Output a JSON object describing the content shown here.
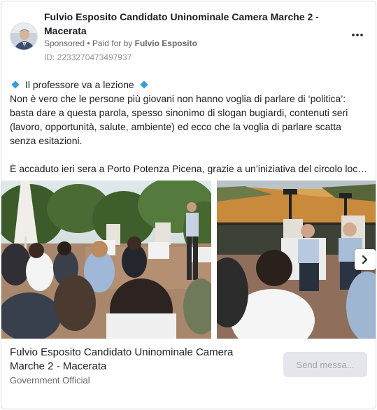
{
  "ad": {
    "page_name": "Fulvio Esposito Candidato Uninominale Camera Marche 2 - Macerata",
    "sponsored_label": "Sponsored",
    "separator": " • ",
    "paid_for_label": "Paid for by ",
    "paid_for_name": "Fulvio Esposito",
    "id_label": "ID: 2233270473497937",
    "more_icon": "more-horizontal-icon"
  },
  "body": {
    "headline": "Il professore va a lezione",
    "paragraph_1": "Non è vero che le persone più giovani non hanno voglia di parlare di ‘politica’: basta dare a questa parola, spesso sinonimo di slogan bugiardi, contenuti seri (lavoro, opportunità, salute, ambiente) ed ecco che la voglia di parlare scatta senza esitazioni.",
    "paragraph_2": "È accaduto ieri sera a Porto Potenza Picena, grazie a un’iniziativa del circolo local...",
    "bullet_icon": "blue-diamond-icon"
  },
  "carousel": {
    "next_icon": "chevron-right-icon",
    "photos": [
      "outdoor-terrace-meeting-photo",
      "terrace-sunset-discussion-photo"
    ]
  },
  "footer": {
    "title": "Fulvio Esposito Candidato Uninominale Camera Marche 2 - Macerata",
    "subtitle": "Government Official",
    "cta_label": "Send messa..."
  },
  "colors": {
    "text": "#1c1e21",
    "secondary": "#65676b",
    "accent_diamond": "#3b9be0",
    "cta_bg": "#e4e6eb"
  }
}
